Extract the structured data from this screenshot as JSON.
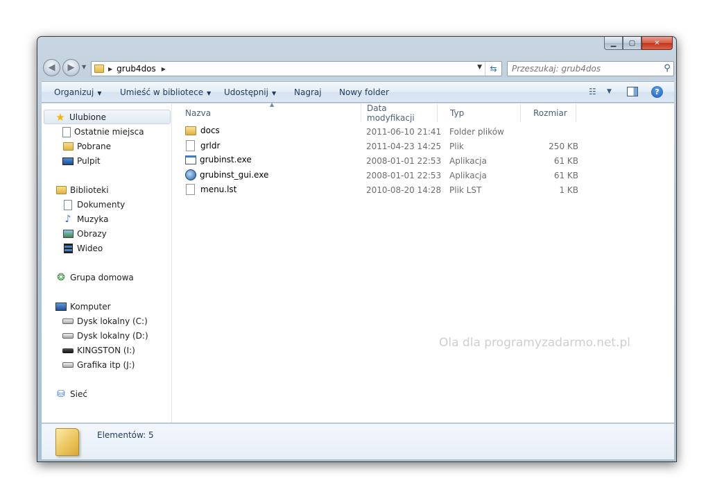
{
  "window": {
    "caption": {
      "minimize": "▁",
      "maximize": "▢",
      "close": "✕"
    }
  },
  "address": {
    "crumbs": [
      "grub4dos"
    ],
    "search_placeholder": "Przeszukaj: grub4dos"
  },
  "commands": {
    "organize": "Organizuj",
    "include_library": "Umieść w bibliotece",
    "share": "Udostępnij",
    "burn": "Nagraj",
    "new_folder": "Nowy folder",
    "help": "?"
  },
  "sidebar": {
    "favorites": {
      "label": "Ulubione",
      "items": [
        "Ostatnie miejsca",
        "Pobrane",
        "Pulpit"
      ]
    },
    "libraries": {
      "label": "Biblioteki",
      "items": [
        "Dokumenty",
        "Muzyka",
        "Obrazy",
        "Wideo"
      ]
    },
    "homegroup": {
      "label": "Grupa domowa"
    },
    "computer": {
      "label": "Komputer",
      "items": [
        "Dysk lokalny (C:)",
        "Dysk lokalny (D:)",
        "KINGSTON (I:)",
        "Grafika itp (J:)"
      ]
    },
    "network": {
      "label": "Sieć"
    }
  },
  "columns": {
    "name": "Nazva",
    "date": "Data modyfikacji",
    "type": "Typ",
    "size": "Rozmiar"
  },
  "files": [
    {
      "name": "docs",
      "date": "2011-06-10 21:41",
      "type": "Folder plików",
      "size": "",
      "icon": "folder-icon"
    },
    {
      "name": "grldr",
      "date": "2011-04-23 14:25",
      "type": "Plik",
      "size": "250 KB",
      "icon": "file-icon"
    },
    {
      "name": "grubinst.exe",
      "date": "2008-01-01 22:53",
      "type": "Aplikacja",
      "size": "61 KB",
      "icon": "exe-icon"
    },
    {
      "name": "grubinst_gui.exe",
      "date": "2008-01-01 22:53",
      "type": "Aplikacja",
      "size": "61 KB",
      "icon": "app-globe-icon"
    },
    {
      "name": "menu.lst",
      "date": "2010-08-20 14:28",
      "type": "Plik LST",
      "size": "1 KB",
      "icon": "file-icon"
    }
  ],
  "watermark": "Ola dla programyzadarmo.net.pl",
  "details": {
    "count": "Elementów: 5"
  }
}
